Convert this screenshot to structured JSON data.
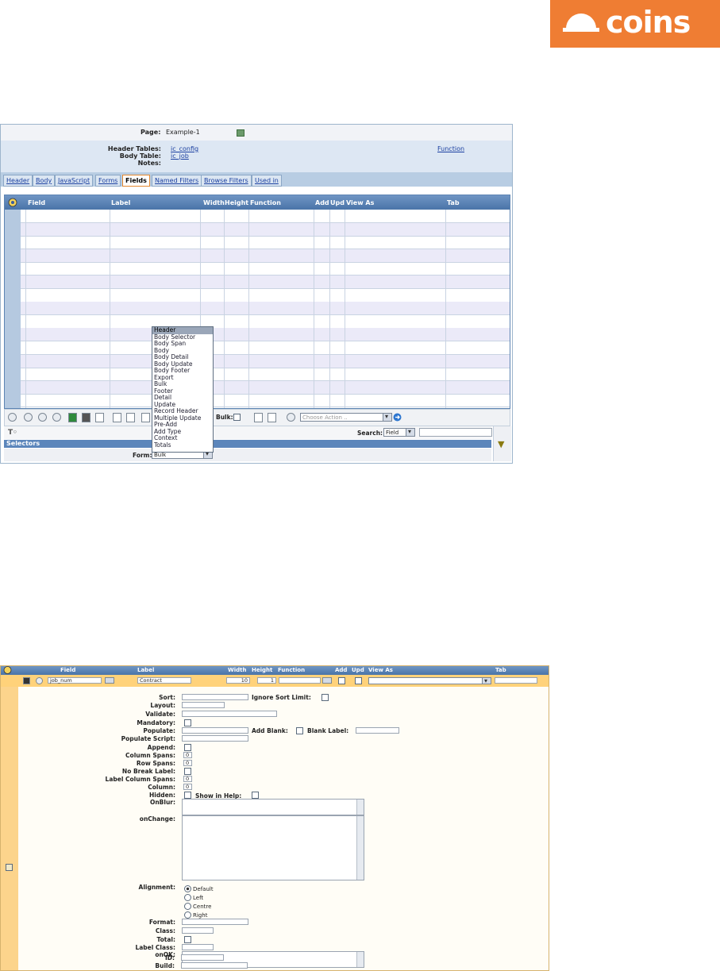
{
  "logo": {
    "text": "coins"
  },
  "page_bar": {
    "label": "Page:",
    "value": "Example-1"
  },
  "header": {
    "header_tables_label": "Header Tables:",
    "header_tables_value": "ic_config",
    "body_table_label": "Body Table:",
    "body_table_value": "ic_job",
    "notes_label": "Notes:",
    "function_link": "Function"
  },
  "tabs": [
    "Header",
    "Body",
    "JavaScript",
    "Forms",
    "Fields",
    "Named Filters",
    "Browse Filters",
    "Used in"
  ],
  "active_tab": "Fields",
  "grid": {
    "columns": [
      "Field",
      "Label",
      "Width",
      "Height",
      "Function",
      "Add",
      "Upd",
      "View As",
      "Tab"
    ]
  },
  "toolbar": {
    "bulk_label": "Bulk:",
    "action_placeholder": "Choose Action .."
  },
  "search": {
    "label": "Search:",
    "field_value": "Field"
  },
  "selectors_label": "Selectors",
  "form": {
    "label": "Form:",
    "value": "Bulk"
  },
  "dropdown_options": [
    "Header",
    "Body Selector",
    "Body Span",
    "Body",
    "Body Detail",
    "Body Update",
    "Body Footer",
    "Export",
    "Bulk",
    "Footer",
    "Detail",
    "Update",
    "Record Header",
    "Multiple Update",
    "Pre-Add",
    "Add Type",
    "Context",
    "Totals"
  ],
  "dropdown_selected": "Header",
  "editor": {
    "columns": [
      "Field",
      "Label",
      "Width",
      "Height",
      "Function",
      "Add",
      "Upd",
      "View As",
      "Tab"
    ],
    "row": {
      "field": "job_num",
      "label": "Contract",
      "width": "10",
      "height": "1"
    },
    "labels": {
      "sort": "Sort:",
      "ignore_sort_limit": "Ignore Sort Limit:",
      "layout": "Layout:",
      "validate": "Validate:",
      "mandatory": "Mandatory:",
      "populate": "Populate:",
      "add_blank": "Add Blank:",
      "blank_label": "Blank Label:",
      "populate_script": "Populate Script:",
      "append": "Append:",
      "column_spans": "Column Spans:",
      "row_spans": "Row Spans:",
      "no_break_label": "No Break Label:",
      "label_column_spans": "Label Column Spans:",
      "column": "Column:",
      "hidden": "Hidden:",
      "show_in_help": "Show in Help:",
      "onblur": "OnBlur:",
      "onchange": "onChange:",
      "alignment": "Alignment:",
      "format": "Format:",
      "class": "Class:",
      "total": "Total:",
      "label_class": "Label Class:",
      "onok": "onOK:",
      "id": "ID:",
      "build": "Build:"
    },
    "values": {
      "column_spans": "0",
      "row_spans": "0",
      "label_column_spans": "0",
      "column": "0"
    },
    "alignment_options": [
      "Default",
      "Left",
      "Centre",
      "Right"
    ],
    "alignment_selected": "Default"
  }
}
